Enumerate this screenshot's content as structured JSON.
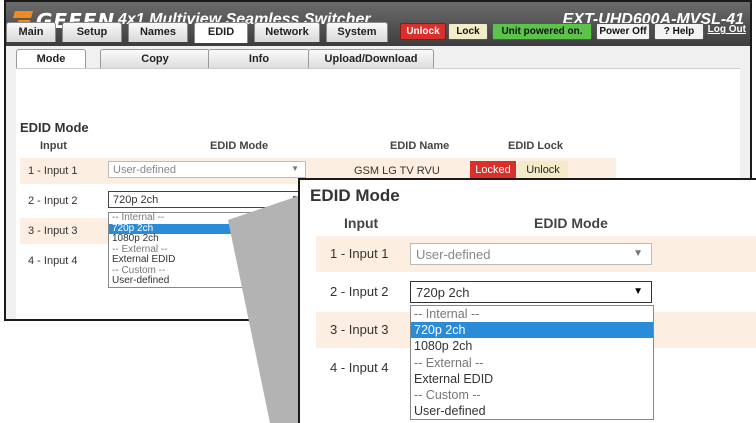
{
  "header": {
    "brand": "GEFEN",
    "app_title": "4x1 Multiview Seamless Switcher",
    "model": "EXT-UHD600A-MVSL-41"
  },
  "nav": {
    "tabs": [
      "Main",
      "Setup",
      "Names",
      "EDID",
      "Network",
      "System"
    ],
    "active_tab": "EDID",
    "unlock_label": "Unlock",
    "lock_label": "Lock",
    "status": "Unit powered on.",
    "power_off_label": "Power Off",
    "help_label": "? Help",
    "logout_label": "Log Out"
  },
  "subnav": {
    "tabs": [
      "Mode",
      "Copy",
      "Info",
      "Upload/Download"
    ],
    "active_tab": "Mode"
  },
  "edid_mode": {
    "section_title": "EDID Mode",
    "columns": [
      "Input",
      "EDID Mode",
      "EDID Name",
      "EDID Lock"
    ],
    "rows": [
      {
        "input": "1 - Input 1",
        "mode": "User-defined",
        "name": "GSM LG TV RVU",
        "lock_btn": "Locked",
        "unlock_btn": "Unlock"
      },
      {
        "input": "2 - Input 2",
        "mode": "720p 2ch"
      },
      {
        "input": "3 - Input 3"
      },
      {
        "input": "4 - Input 4"
      }
    ],
    "dropdown_options": [
      {
        "label": "-- Internal --",
        "group": true
      },
      {
        "label": "720p 2ch",
        "selected": true
      },
      {
        "label": "1080p 2ch"
      },
      {
        "label": "-- External --",
        "group": true
      },
      {
        "label": "External EDID"
      },
      {
        "label": "-- Custom --",
        "group": true
      },
      {
        "label": "User-defined"
      }
    ]
  },
  "colors": {
    "accent": "#f08a1c",
    "unlock_btn": "#d9302b",
    "lock_btn": "#f3ecc8",
    "status_green": "#5cc34a",
    "locked_red": "#d9302b",
    "row_alt": "#fcefe1",
    "highlight": "#2a8bd8"
  }
}
